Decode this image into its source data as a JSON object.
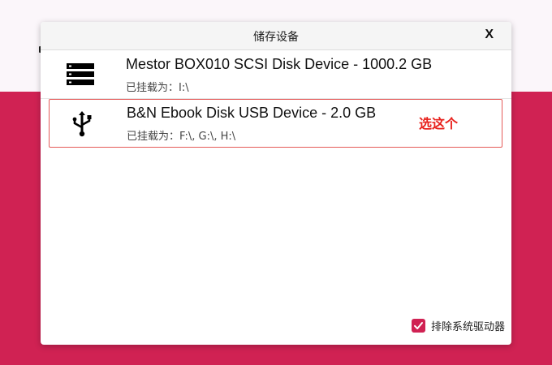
{
  "dialog": {
    "title": "储存设备",
    "close_label": "X"
  },
  "devices": [
    {
      "name": "Mestor BOX010 SCSI Disk Device - 1000.2 GB",
      "mount": "已挂载为：I:\\",
      "icon": "server-drive-icon"
    },
    {
      "name": "B&N Ebook Disk USB Device - 2.0 GB",
      "mount": "已挂载为：F:\\, G:\\, H:\\",
      "icon": "usb-icon",
      "highlighted": true,
      "annotation": "选这个"
    }
  ],
  "footer": {
    "exclude_system_label": "排除系统驱动器",
    "exclude_system_checked": true
  },
  "colors": {
    "accent": "#d02253",
    "highlight_border": "#e55a58",
    "annotation": "#e8211c"
  }
}
